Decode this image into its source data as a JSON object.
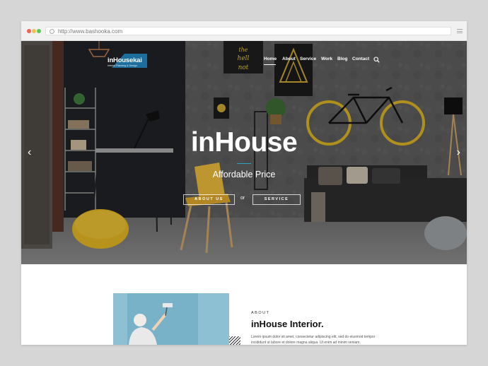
{
  "browser": {
    "url": "http://www.bashooka.com"
  },
  "site": {
    "logo": {
      "name": "inHousekai",
      "tagline": "Interior Planning & Design"
    },
    "nav": [
      {
        "label": "Home",
        "active": true
      },
      {
        "label": "About",
        "active": false
      },
      {
        "label": "Service",
        "active": false
      },
      {
        "label": "Work",
        "active": false
      },
      {
        "label": "Blog",
        "active": false
      },
      {
        "label": "Contact",
        "active": false
      }
    ],
    "search_icon": "search-icon"
  },
  "hero": {
    "title": "inHouse",
    "subtitle": "Affordable Price",
    "btn_about": "ABOUT US",
    "or_text": "or",
    "btn_service": "SERVICE",
    "arrow_left": "‹",
    "arrow_right": "›",
    "poster_text": "the hell not"
  },
  "about": {
    "label": "ABOUT",
    "title": "inHouse Interior.",
    "text": "Lorem ipsum dolor sit amet, consectetur adipiscing elit, sed do eiusmod tempor incididunt ut labore et dolore magna aliqua. Ut enim ad minim veniam,"
  },
  "colors": {
    "accent": "#2ba4c4",
    "logo_blue": "#1c6e9e",
    "bike_yellow": "#d6b024",
    "chair_yellow": "#e7b83a"
  }
}
